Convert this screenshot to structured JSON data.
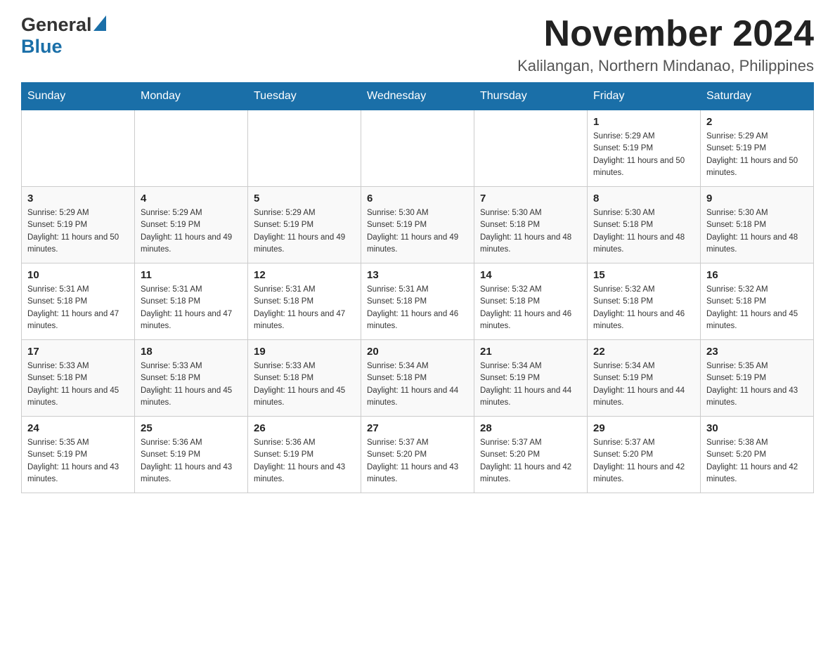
{
  "header": {
    "logo": {
      "general": "General",
      "blue": "Blue"
    },
    "title": "November 2024",
    "location": "Kalilangan, Northern Mindanao, Philippines"
  },
  "calendar": {
    "days_of_week": [
      "Sunday",
      "Monday",
      "Tuesday",
      "Wednesday",
      "Thursday",
      "Friday",
      "Saturday"
    ],
    "weeks": [
      [
        {
          "day": "",
          "info": ""
        },
        {
          "day": "",
          "info": ""
        },
        {
          "day": "",
          "info": ""
        },
        {
          "day": "",
          "info": ""
        },
        {
          "day": "",
          "info": ""
        },
        {
          "day": "1",
          "info": "Sunrise: 5:29 AM\nSunset: 5:19 PM\nDaylight: 11 hours and 50 minutes."
        },
        {
          "day": "2",
          "info": "Sunrise: 5:29 AM\nSunset: 5:19 PM\nDaylight: 11 hours and 50 minutes."
        }
      ],
      [
        {
          "day": "3",
          "info": "Sunrise: 5:29 AM\nSunset: 5:19 PM\nDaylight: 11 hours and 50 minutes."
        },
        {
          "day": "4",
          "info": "Sunrise: 5:29 AM\nSunset: 5:19 PM\nDaylight: 11 hours and 49 minutes."
        },
        {
          "day": "5",
          "info": "Sunrise: 5:29 AM\nSunset: 5:19 PM\nDaylight: 11 hours and 49 minutes."
        },
        {
          "day": "6",
          "info": "Sunrise: 5:30 AM\nSunset: 5:19 PM\nDaylight: 11 hours and 49 minutes."
        },
        {
          "day": "7",
          "info": "Sunrise: 5:30 AM\nSunset: 5:18 PM\nDaylight: 11 hours and 48 minutes."
        },
        {
          "day": "8",
          "info": "Sunrise: 5:30 AM\nSunset: 5:18 PM\nDaylight: 11 hours and 48 minutes."
        },
        {
          "day": "9",
          "info": "Sunrise: 5:30 AM\nSunset: 5:18 PM\nDaylight: 11 hours and 48 minutes."
        }
      ],
      [
        {
          "day": "10",
          "info": "Sunrise: 5:31 AM\nSunset: 5:18 PM\nDaylight: 11 hours and 47 minutes."
        },
        {
          "day": "11",
          "info": "Sunrise: 5:31 AM\nSunset: 5:18 PM\nDaylight: 11 hours and 47 minutes."
        },
        {
          "day": "12",
          "info": "Sunrise: 5:31 AM\nSunset: 5:18 PM\nDaylight: 11 hours and 47 minutes."
        },
        {
          "day": "13",
          "info": "Sunrise: 5:31 AM\nSunset: 5:18 PM\nDaylight: 11 hours and 46 minutes."
        },
        {
          "day": "14",
          "info": "Sunrise: 5:32 AM\nSunset: 5:18 PM\nDaylight: 11 hours and 46 minutes."
        },
        {
          "day": "15",
          "info": "Sunrise: 5:32 AM\nSunset: 5:18 PM\nDaylight: 11 hours and 46 minutes."
        },
        {
          "day": "16",
          "info": "Sunrise: 5:32 AM\nSunset: 5:18 PM\nDaylight: 11 hours and 45 minutes."
        }
      ],
      [
        {
          "day": "17",
          "info": "Sunrise: 5:33 AM\nSunset: 5:18 PM\nDaylight: 11 hours and 45 minutes."
        },
        {
          "day": "18",
          "info": "Sunrise: 5:33 AM\nSunset: 5:18 PM\nDaylight: 11 hours and 45 minutes."
        },
        {
          "day": "19",
          "info": "Sunrise: 5:33 AM\nSunset: 5:18 PM\nDaylight: 11 hours and 45 minutes."
        },
        {
          "day": "20",
          "info": "Sunrise: 5:34 AM\nSunset: 5:18 PM\nDaylight: 11 hours and 44 minutes."
        },
        {
          "day": "21",
          "info": "Sunrise: 5:34 AM\nSunset: 5:19 PM\nDaylight: 11 hours and 44 minutes."
        },
        {
          "day": "22",
          "info": "Sunrise: 5:34 AM\nSunset: 5:19 PM\nDaylight: 11 hours and 44 minutes."
        },
        {
          "day": "23",
          "info": "Sunrise: 5:35 AM\nSunset: 5:19 PM\nDaylight: 11 hours and 43 minutes."
        }
      ],
      [
        {
          "day": "24",
          "info": "Sunrise: 5:35 AM\nSunset: 5:19 PM\nDaylight: 11 hours and 43 minutes."
        },
        {
          "day": "25",
          "info": "Sunrise: 5:36 AM\nSunset: 5:19 PM\nDaylight: 11 hours and 43 minutes."
        },
        {
          "day": "26",
          "info": "Sunrise: 5:36 AM\nSunset: 5:19 PM\nDaylight: 11 hours and 43 minutes."
        },
        {
          "day": "27",
          "info": "Sunrise: 5:37 AM\nSunset: 5:20 PM\nDaylight: 11 hours and 43 minutes."
        },
        {
          "day": "28",
          "info": "Sunrise: 5:37 AM\nSunset: 5:20 PM\nDaylight: 11 hours and 42 minutes."
        },
        {
          "day": "29",
          "info": "Sunrise: 5:37 AM\nSunset: 5:20 PM\nDaylight: 11 hours and 42 minutes."
        },
        {
          "day": "30",
          "info": "Sunrise: 5:38 AM\nSunset: 5:20 PM\nDaylight: 11 hours and 42 minutes."
        }
      ]
    ]
  }
}
